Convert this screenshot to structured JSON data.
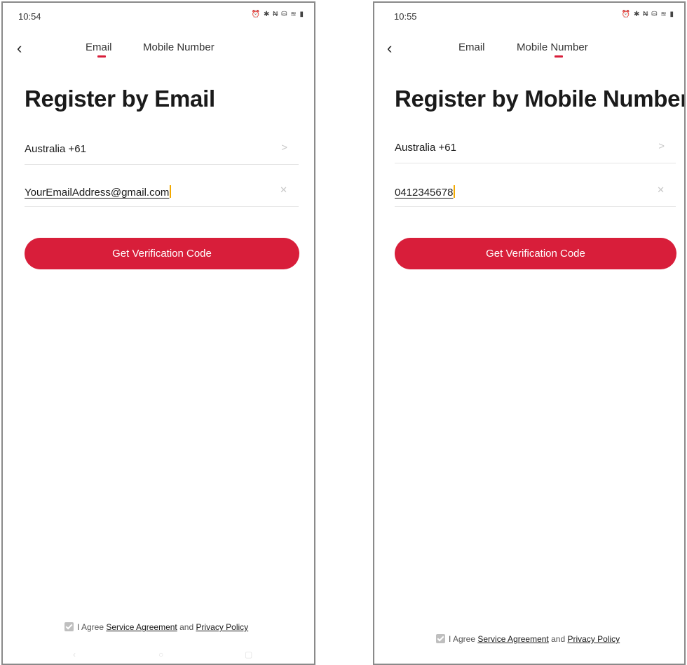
{
  "left": {
    "status": {
      "time": "10:54",
      "icons": "⏰ ✱ ₦ ⛁ ≋ ▮"
    },
    "tabs": [
      {
        "label": "Email"
      },
      {
        "label": "Mobile Number"
      }
    ],
    "title": "Register by Email",
    "country": {
      "value": "Australia +61"
    },
    "input": {
      "value": "YourEmailAddress@gmail.com"
    },
    "button_label": "Get Verification Code",
    "agree": {
      "prefix": "I Agree",
      "service": "Service Agreement",
      "and": "and",
      "privacy": "Privacy Policy"
    }
  },
  "right": {
    "status": {
      "time": "10:55",
      "icons": "⏰ ✱ ₦ ⛁ ≋ ▮"
    },
    "tabs": [
      {
        "label": "Email"
      },
      {
        "label": "Mobile Number"
      }
    ],
    "title": "Register by Mobile Number",
    "country": {
      "value": "Australia +61"
    },
    "input": {
      "value": "0412345678"
    },
    "button_label": "Get Verification Code",
    "agree": {
      "prefix": "I Agree",
      "service": "Service Agreement",
      "and": "and",
      "privacy": "Privacy Policy"
    }
  },
  "colors": {
    "accent": "#d81e3a",
    "caret": "#f2a900",
    "divider": "#e6e6e6"
  },
  "icons": {
    "back": "chevron-left-icon",
    "row_more": "chevron-right-icon",
    "clear": "close-icon",
    "agree": "checkbox-icon"
  }
}
